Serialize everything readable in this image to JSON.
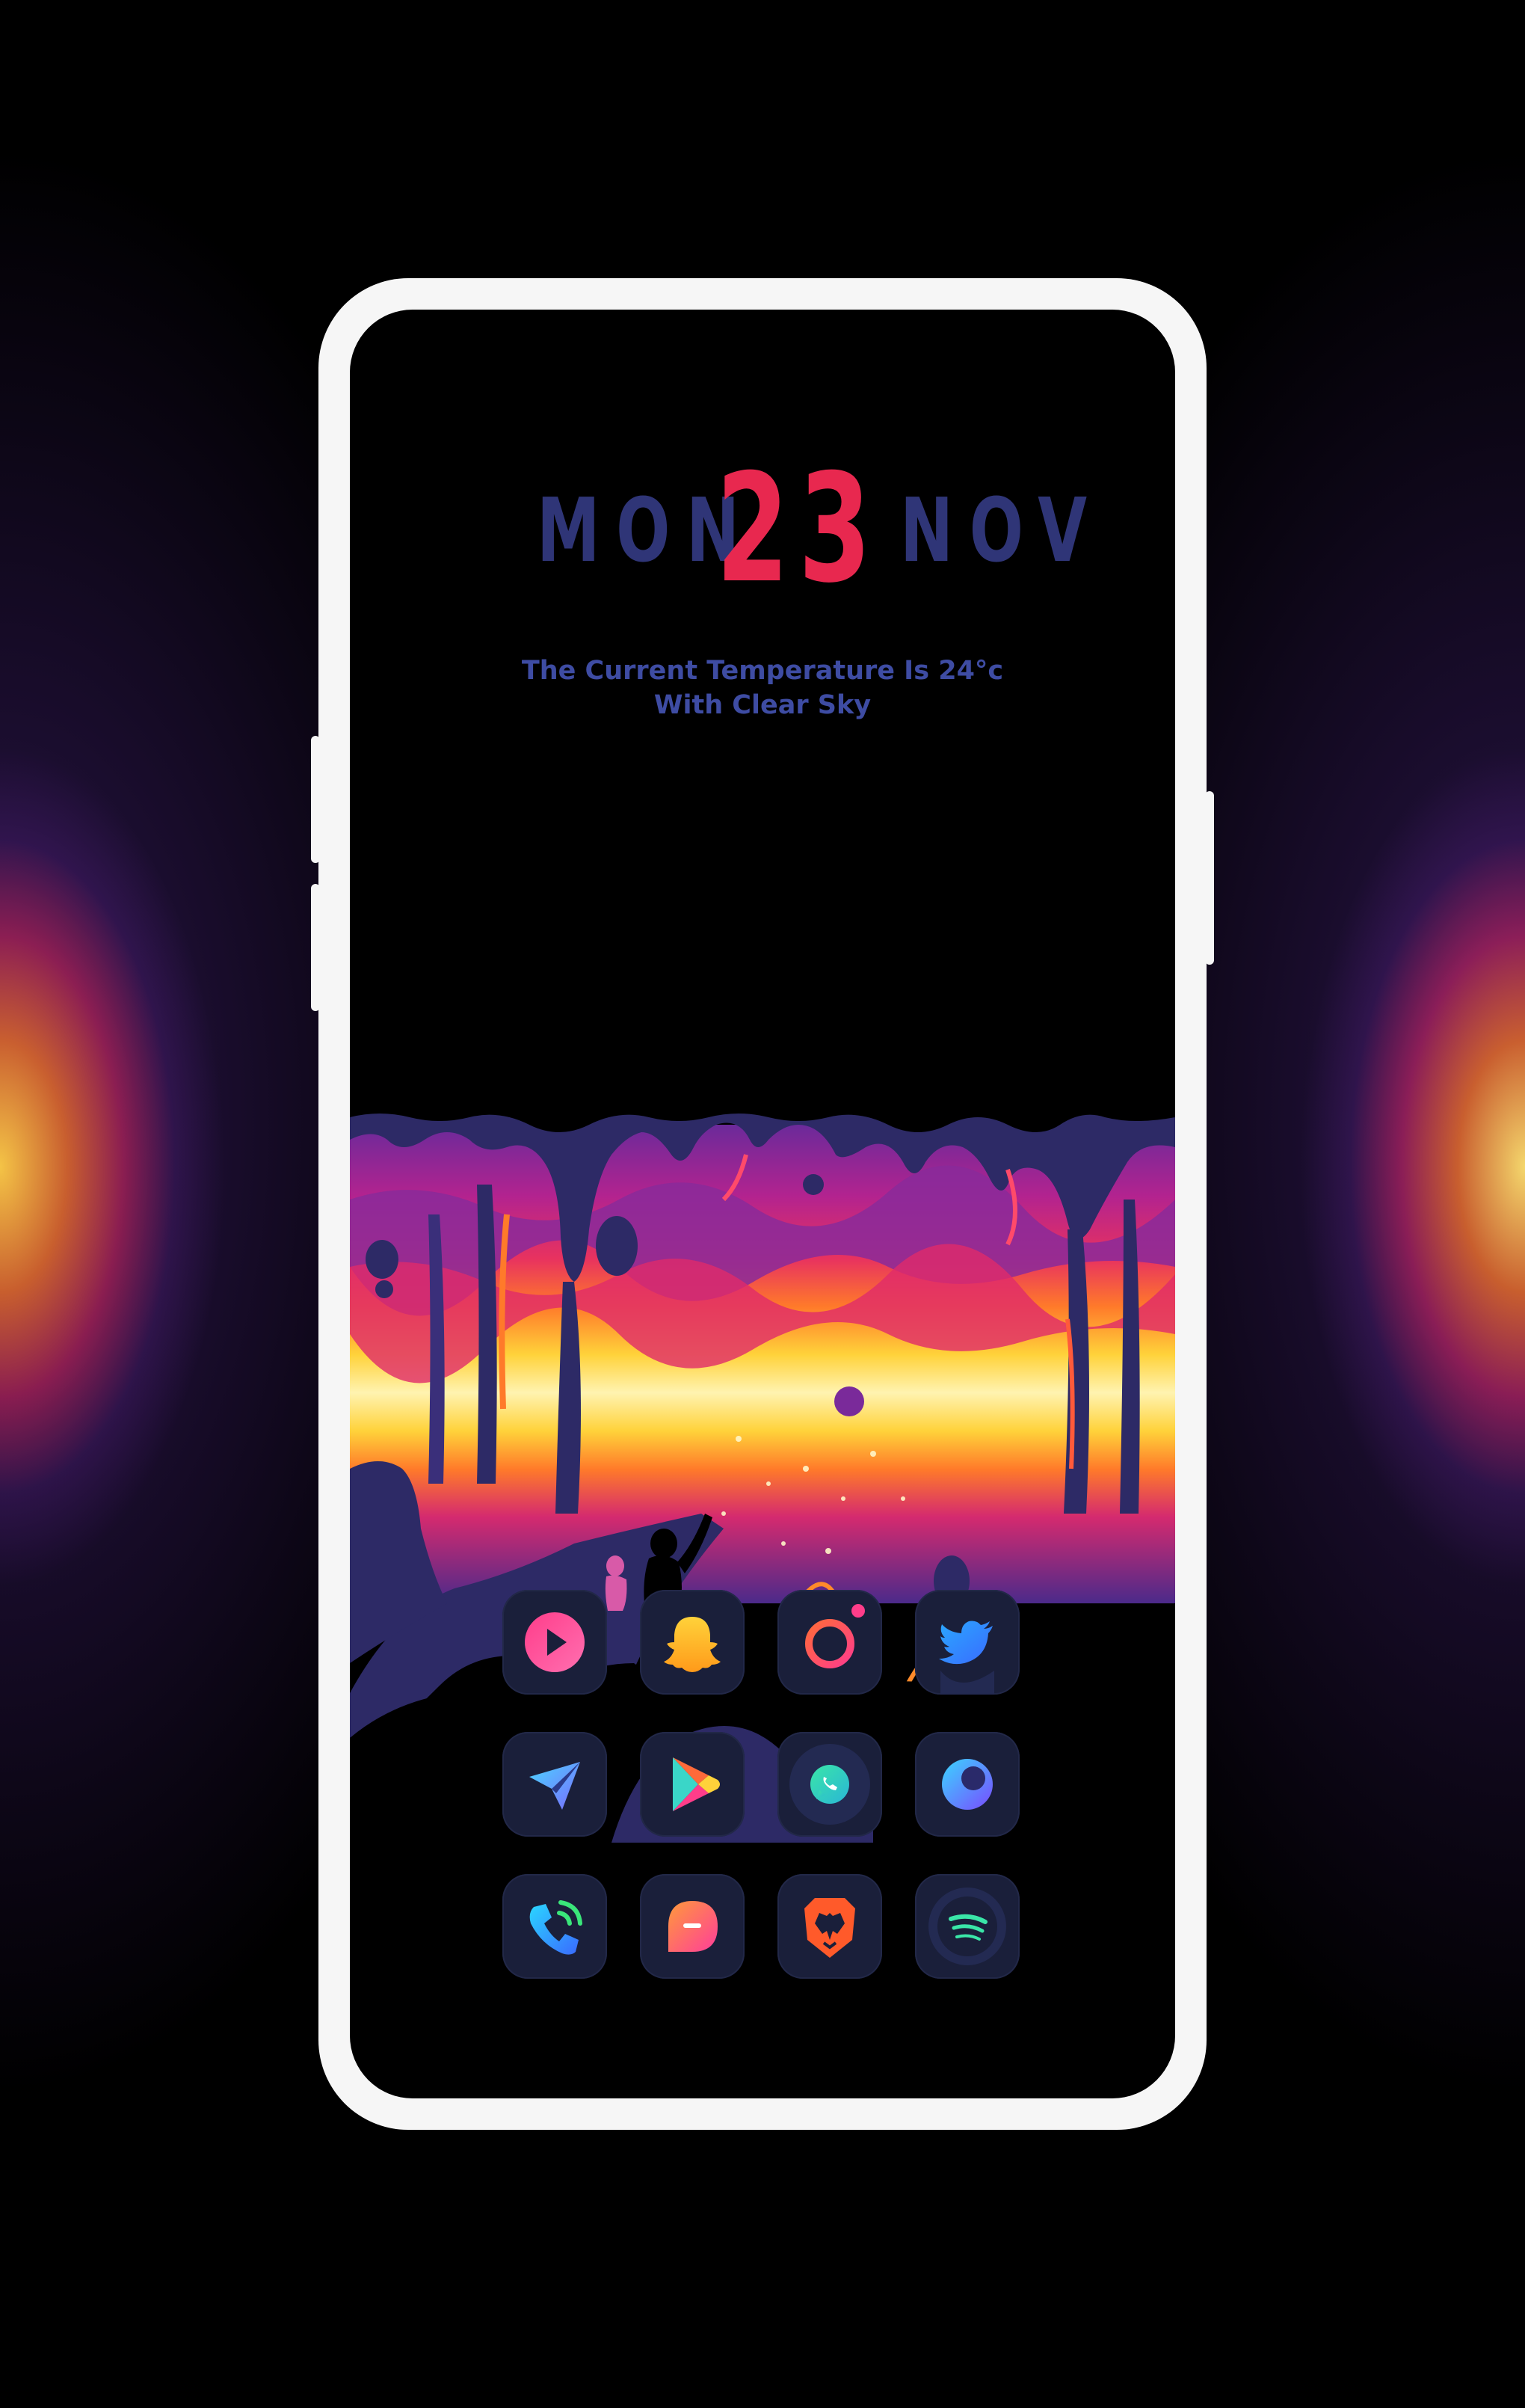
{
  "clock": {
    "weekday": "MON",
    "day": "23",
    "month": "NOV"
  },
  "weather": {
    "line1": "The Current Temperature Is 24°c",
    "line2": "With Clear Sky"
  },
  "apps": [
    {
      "icon": "youtube-play-icon"
    },
    {
      "icon": "snapchat-icon"
    },
    {
      "icon": "camera-icon"
    },
    {
      "icon": "twitter-icon"
    },
    {
      "icon": "telegram-send-icon"
    },
    {
      "icon": "play-store-icon"
    },
    {
      "icon": "whatsapp-icon"
    },
    {
      "icon": "browser-icon"
    },
    {
      "icon": "phone-icon"
    },
    {
      "icon": "messages-icon"
    },
    {
      "icon": "brave-lion-icon"
    },
    {
      "icon": "spotify-icon"
    }
  ],
  "colors": {
    "clock_word": "#2f3577",
    "clock_day": "#e8284f",
    "weather_text": "#3e4ca3",
    "icon_tile": "#1a1f3a",
    "phone_frame": "#f6f6f6"
  }
}
